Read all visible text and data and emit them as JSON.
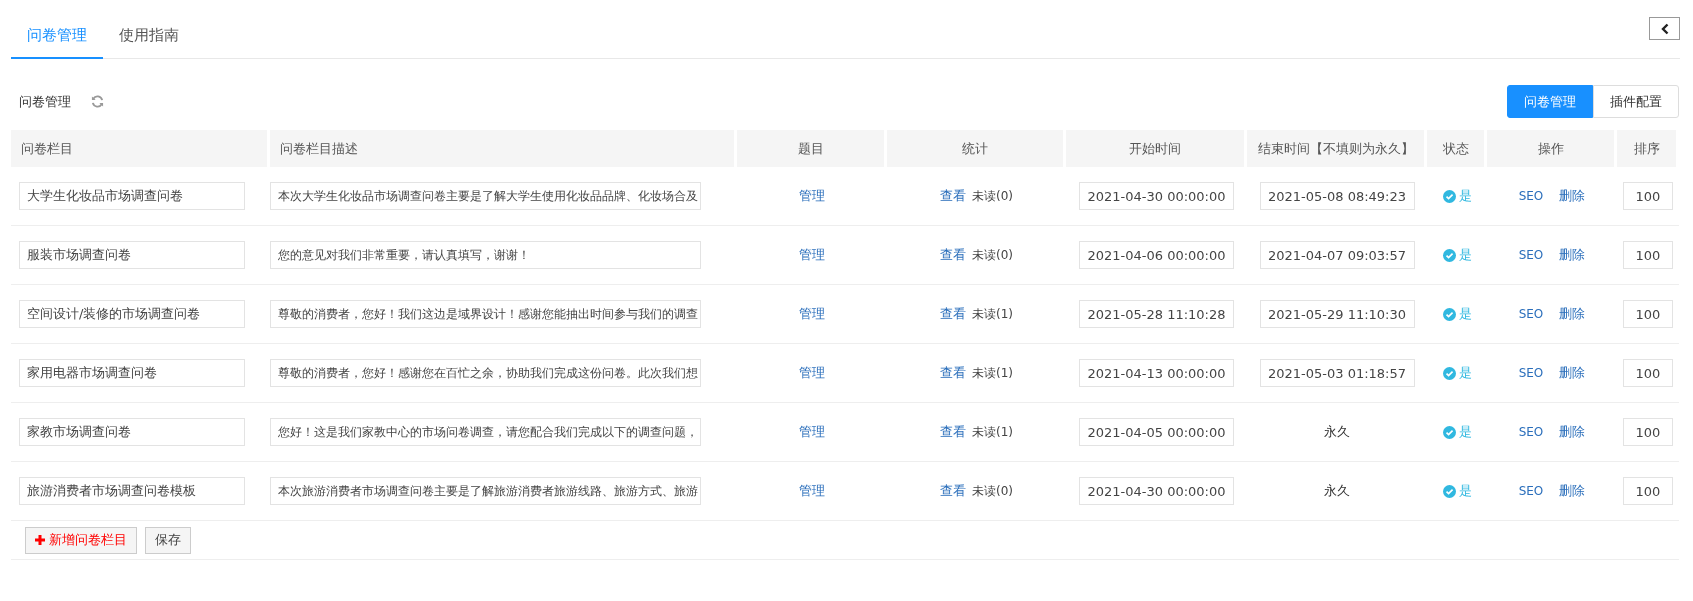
{
  "tabs": [
    {
      "label": "问卷管理",
      "selected": true
    },
    {
      "label": "使用指南",
      "selected": false
    }
  ],
  "panel": {
    "title": "问卷管理",
    "views": [
      {
        "label": "问卷管理",
        "selected": true
      },
      {
        "label": "插件配置",
        "selected": false
      }
    ]
  },
  "table": {
    "columns": [
      "问卷栏目",
      "问卷栏目描述",
      "题目",
      "统计",
      "开始时间",
      "结束时间【不填则为永久】",
      "状态",
      "操作",
      "排序"
    ],
    "rows": [
      {
        "name": "大学生化妆品市场调查问卷",
        "description": "本次大学生化妆品市场调查问卷主要是了解大学生使用化妆品品牌、化妆场合及",
        "manage": "管理",
        "view": "查看",
        "unread": "未读(0)",
        "start": "2021-04-30 00:00:00",
        "end": {
          "kind": "field",
          "value": "2021-05-08 08:49:23"
        },
        "status": {
          "enabled": true,
          "label": "是"
        },
        "seo": "SEO",
        "delete": "删除",
        "order": "100"
      },
      {
        "name": "服装市场调查问卷",
        "description": "您的意见对我们非常重要，请认真填写，谢谢！",
        "manage": "管理",
        "view": "查看",
        "unread": "未读(0)",
        "start": "2021-04-06 00:00:00",
        "end": {
          "kind": "field",
          "value": "2021-04-07 09:03:57"
        },
        "status": {
          "enabled": true,
          "label": "是"
        },
        "seo": "SEO",
        "delete": "删除",
        "order": "100"
      },
      {
        "name": "空间设计/装修的市场调查问卷",
        "description": "尊敬的消费者，您好！我们这边是域界设计！感谢您能抽出时间参与我们的调查",
        "manage": "管理",
        "view": "查看",
        "unread": "未读(1)",
        "start": "2021-05-28 11:10:28",
        "end": {
          "kind": "field",
          "value": "2021-05-29 11:10:30"
        },
        "status": {
          "enabled": true,
          "label": "是"
        },
        "seo": "SEO",
        "delete": "删除",
        "order": "100"
      },
      {
        "name": "家用电器市场调查问卷",
        "description": "尊敬的消费者，您好！感谢您在百忙之余，协助我们完成这份问卷。此次我们想",
        "manage": "管理",
        "view": "查看",
        "unread": "未读(1)",
        "start": "2021-04-13 00:00:00",
        "end": {
          "kind": "field",
          "value": "2021-05-03 01:18:57"
        },
        "status": {
          "enabled": true,
          "label": "是"
        },
        "seo": "SEO",
        "delete": "删除",
        "order": "100"
      },
      {
        "name": "家教市场调查问卷",
        "description": "您好！这是我们家教中心的市场问卷调查，请您配合我们完成以下的调查问题，",
        "manage": "管理",
        "view": "查看",
        "unread": "未读(1)",
        "start": "2021-04-05 00:00:00",
        "end": {
          "kind": "text",
          "value": "永久"
        },
        "status": {
          "enabled": true,
          "label": "是"
        },
        "seo": "SEO",
        "delete": "删除",
        "order": "100"
      },
      {
        "name": "旅游消费者市场调查问卷模板",
        "description": "本次旅游消费者市场调查问卷主要是了解旅游消费者旅游线路、旅游方式、旅游",
        "manage": "管理",
        "view": "查看",
        "unread": "未读(0)",
        "start": "2021-04-30 00:00:00",
        "end": {
          "kind": "text",
          "value": "永久"
        },
        "status": {
          "enabled": true,
          "label": "是"
        },
        "seo": "SEO",
        "delete": "删除",
        "order": "100"
      }
    ]
  },
  "actions": {
    "add": "新增问卷栏目",
    "save": "保存"
  }
}
